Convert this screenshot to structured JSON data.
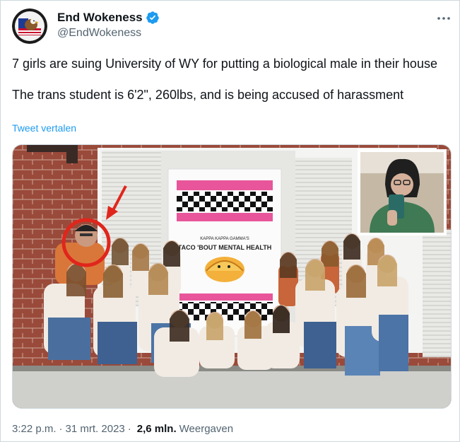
{
  "author": {
    "name": "End Wokeness",
    "handle": "@EndWokeness",
    "avatar_icon": "eagle-seal-avatar-icon",
    "verified_icon": "verified-badge-icon",
    "verified_color": "#1d9bf0"
  },
  "tweet": {
    "paragraph_1": "7 girls are suing University of WY for putting a biological male in their house",
    "paragraph_2": "The trans student is 6'2\", 260lbs, and is being accused of harassment",
    "translate_label": "Tweet vertalen"
  },
  "media": {
    "banner_line_1": "KAPPA KAPPA GAMMA'S",
    "banner_line_2": "TACO 'BOUT MENTAL HEALTH",
    "highlight_icon": "red-circle-annotation-icon",
    "arrow_icon": "red-arrow-icon"
  },
  "meta": {
    "time": "3:22 p.m.",
    "date": "31 mrt. 2023",
    "views_count": "2,6 mln.",
    "views_label": "Weergaven",
    "separator": "·"
  },
  "colors": {
    "text_primary": "#0f1419",
    "text_secondary": "#536471",
    "link": "#1d9bf0",
    "border": "#cfd9de",
    "annotation_red": "#e0261c"
  }
}
